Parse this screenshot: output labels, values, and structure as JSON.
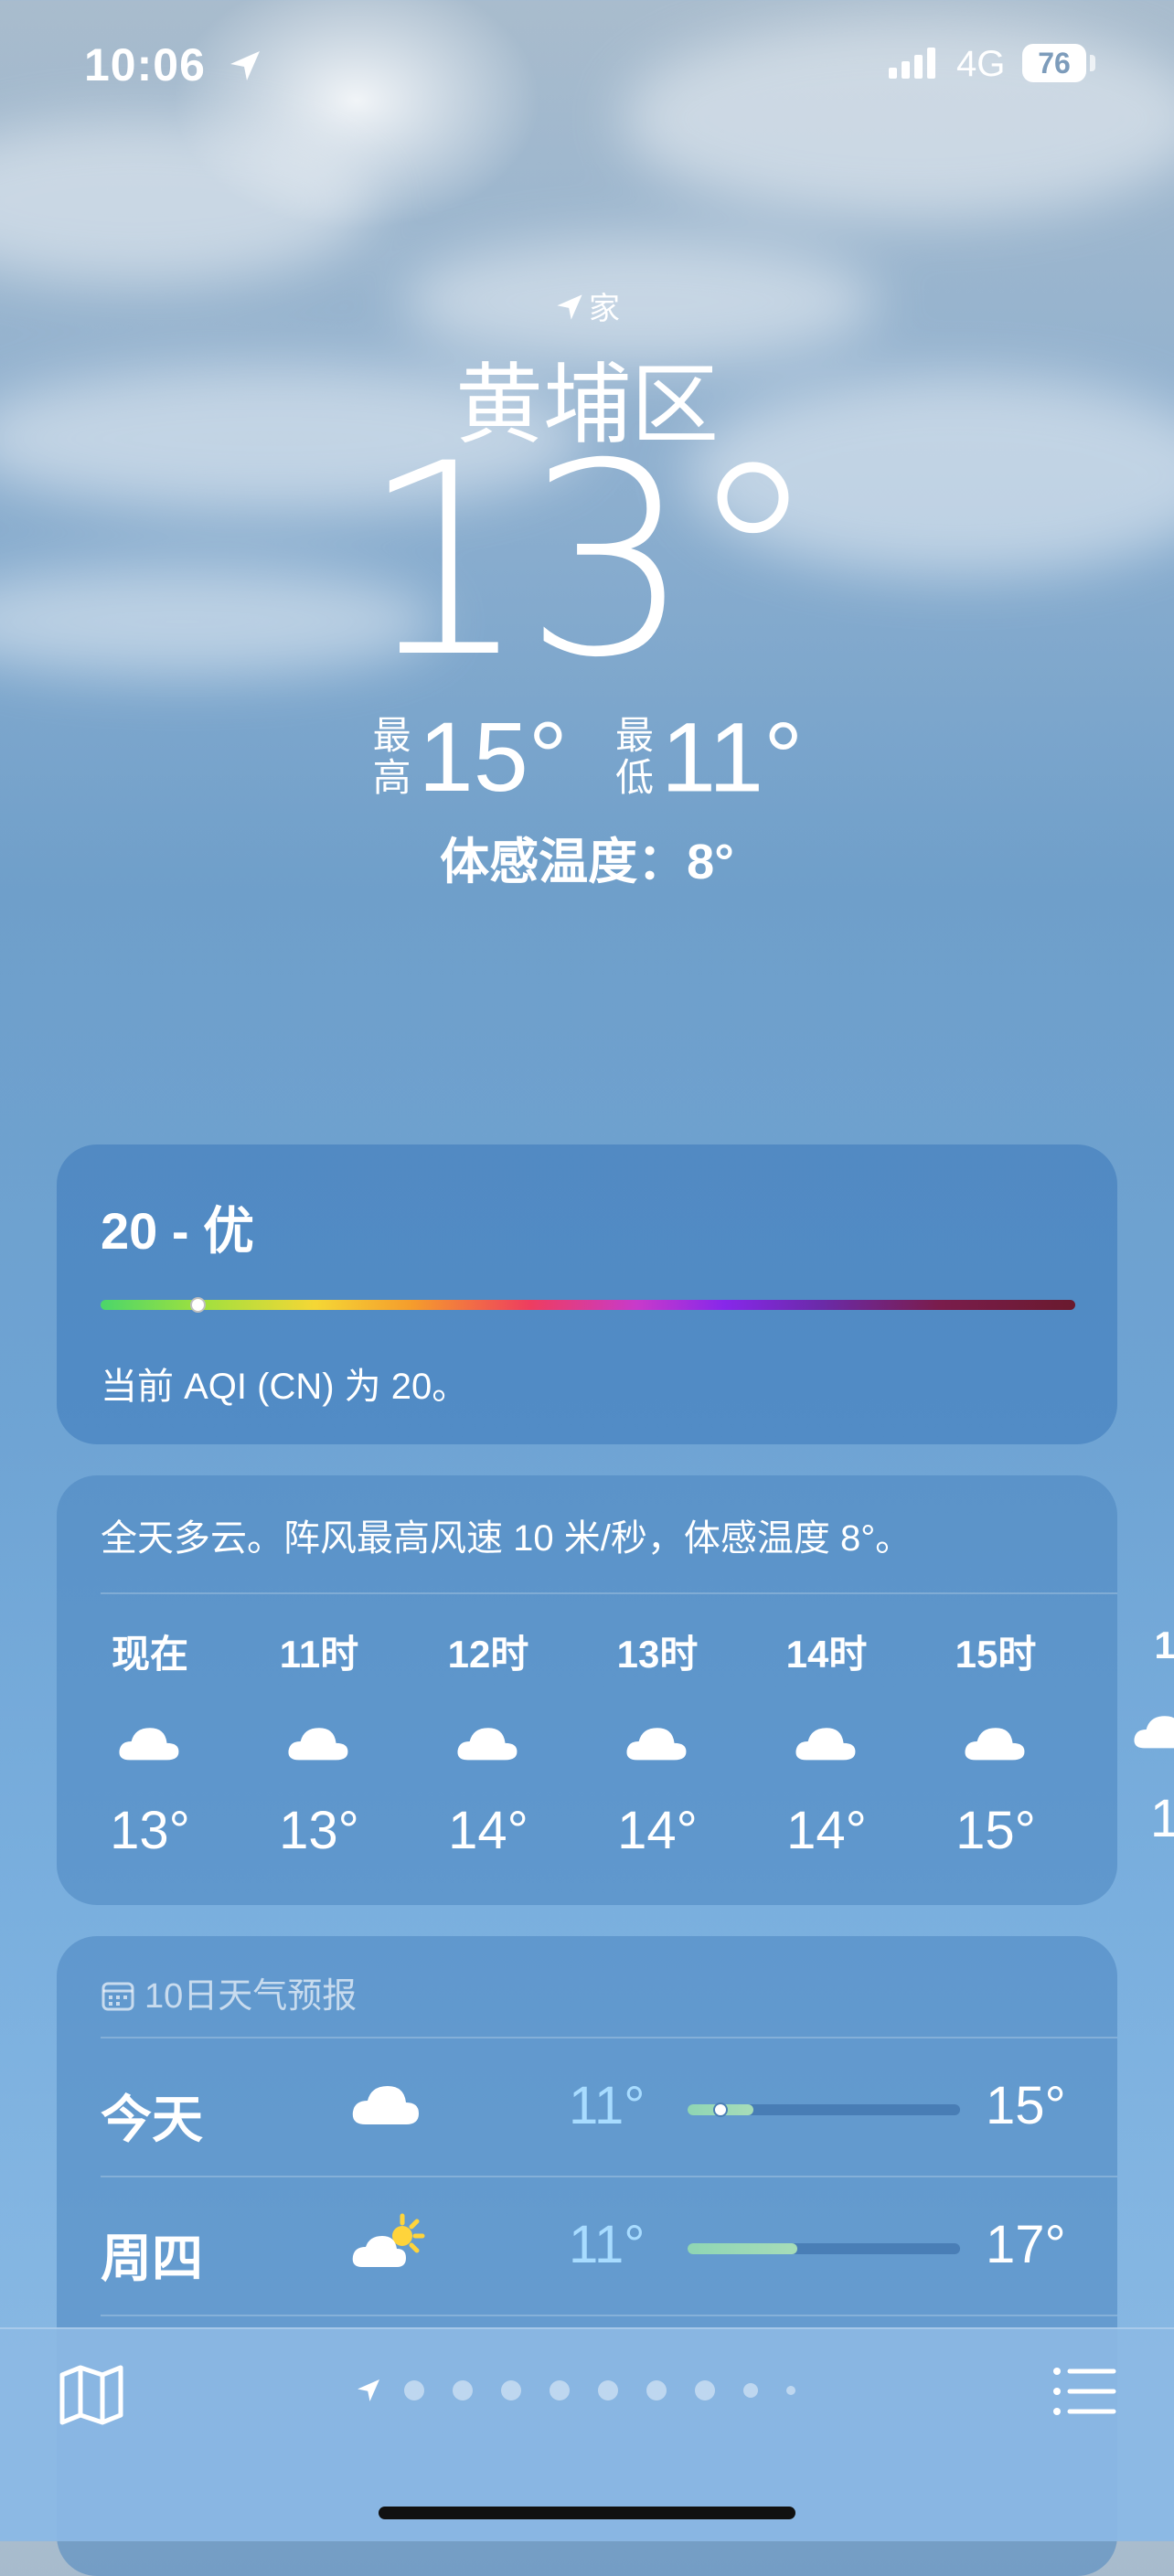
{
  "status": {
    "time": "10:06",
    "network": "4G",
    "battery": "76"
  },
  "hero": {
    "home_label": "家",
    "city": "黄埔区",
    "temperature": "13°",
    "high_label": "最高",
    "high": "15°",
    "low_label": "最低",
    "low": "11°",
    "feels_like": "体感温度：8°"
  },
  "aqi": {
    "title": "20 - 优",
    "description": "当前 AQI (CN) 为 20。",
    "value_fraction": 0.045
  },
  "hourly": {
    "summary": "全天多云。阵风最高风速 10 米/秒，体感温度 8°。",
    "items": [
      {
        "time": "现在",
        "temp": "13°",
        "icon": "cloud-icon"
      },
      {
        "time": "11时",
        "temp": "13°",
        "icon": "cloud-icon"
      },
      {
        "time": "12时",
        "temp": "14°",
        "icon": "cloud-icon"
      },
      {
        "time": "13时",
        "temp": "14°",
        "icon": "cloud-icon"
      },
      {
        "time": "14时",
        "temp": "14°",
        "icon": "cloud-icon"
      },
      {
        "time": "15时",
        "temp": "15°",
        "icon": "cloud-icon"
      },
      {
        "time": "1",
        "temp": "1",
        "icon": "cloud-icon"
      }
    ]
  },
  "tenday": {
    "header": "10日天气预报",
    "days": [
      {
        "name": "今天",
        "icon": "cloud-icon",
        "low": "11°",
        "high": "15°"
      },
      {
        "name": "周四",
        "icon": "partly-sunny-icon",
        "low": "11°",
        "high": "17°"
      }
    ]
  },
  "bottom_bar": {
    "page_count": 9,
    "current_page": 1
  },
  "colors": {
    "accent_low": "#a8dcff",
    "card_bg": "#4a85c0"
  }
}
